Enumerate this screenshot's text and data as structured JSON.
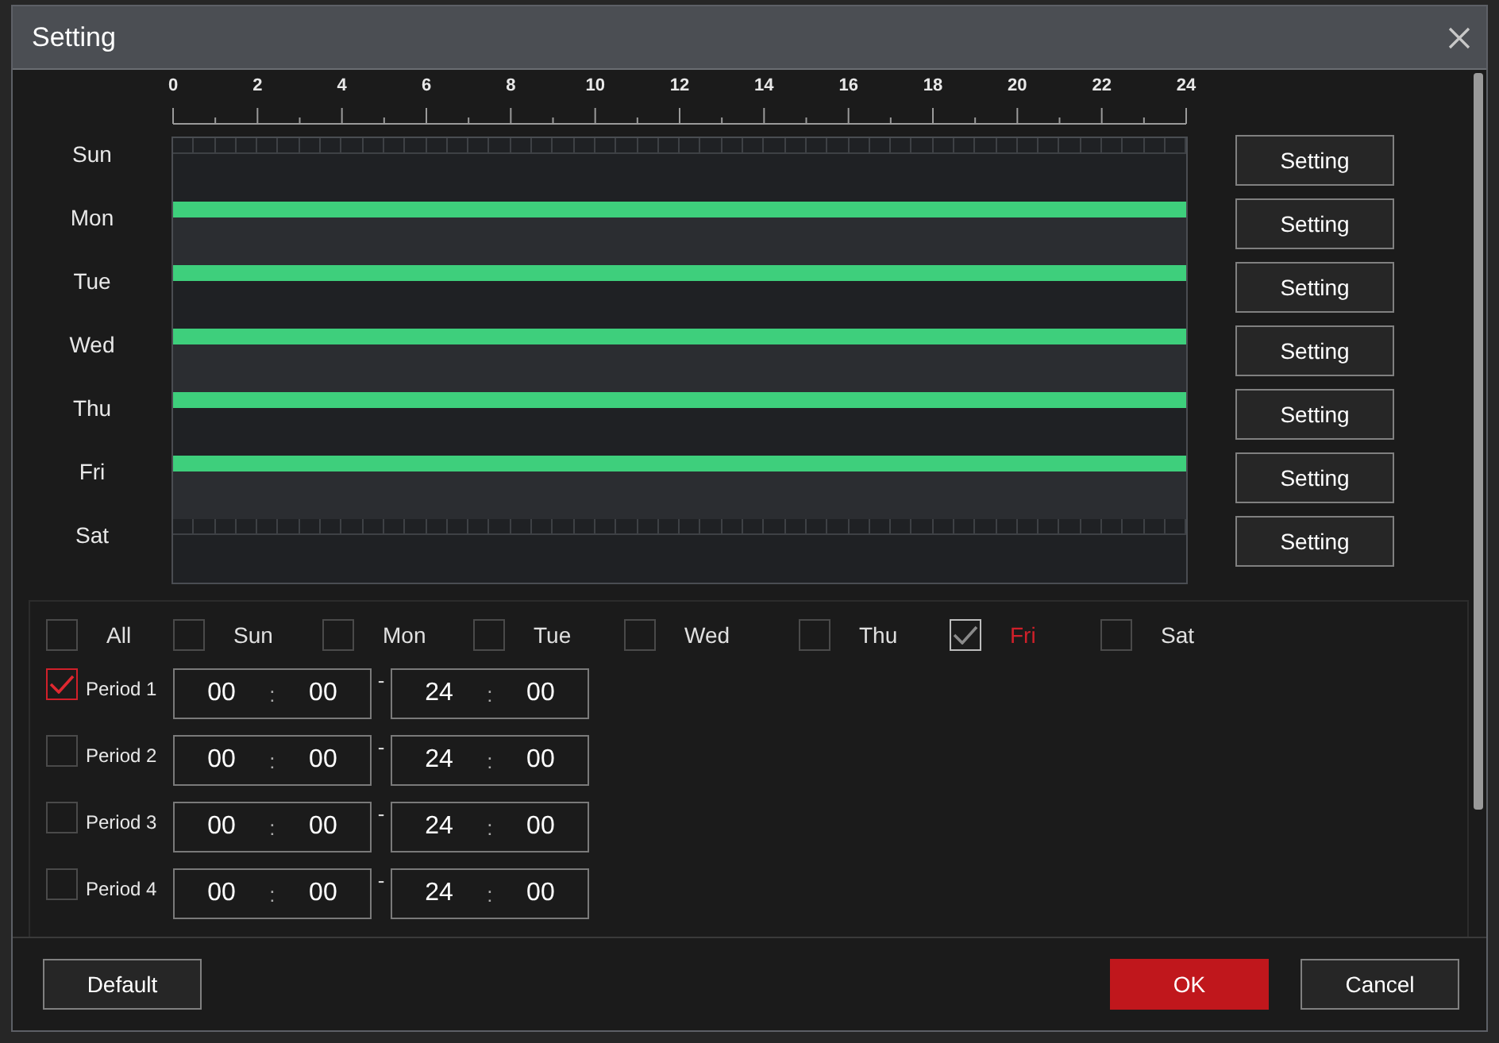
{
  "window": {
    "title": "Setting"
  },
  "axis": {
    "labels": [
      "0",
      "2",
      "4",
      "6",
      "8",
      "10",
      "12",
      "14",
      "16",
      "18",
      "20",
      "22",
      "24"
    ]
  },
  "days": [
    {
      "label": "Sun",
      "kind": "grid",
      "button": "Setting"
    },
    {
      "label": "Mon",
      "kind": "bar",
      "level": 1,
      "button": "Setting"
    },
    {
      "label": "Tue",
      "kind": "bar",
      "level": 1,
      "button": "Setting"
    },
    {
      "label": "Wed",
      "kind": "bar",
      "level": 1,
      "button": "Setting"
    },
    {
      "label": "Thu",
      "kind": "bar",
      "level": 1,
      "button": "Setting"
    },
    {
      "label": "Fri",
      "kind": "bar",
      "level": 1,
      "button": "Setting"
    },
    {
      "label": "Sat",
      "kind": "grid",
      "button": "Setting"
    }
  ],
  "day_checks": [
    {
      "label": "All",
      "checked": false,
      "selected": false
    },
    {
      "label": "Sun",
      "checked": false,
      "selected": false
    },
    {
      "label": "Mon",
      "checked": false,
      "selected": false
    },
    {
      "label": "Tue",
      "checked": false,
      "selected": false
    },
    {
      "label": "Wed",
      "checked": false,
      "selected": false
    },
    {
      "label": "Thu",
      "checked": false,
      "selected": false
    },
    {
      "label": "Fri",
      "checked": true,
      "selected": true
    },
    {
      "label": "Sat",
      "checked": false,
      "selected": false
    }
  ],
  "periods": [
    {
      "label": "Period 1",
      "checked": true,
      "start": {
        "hour": "00",
        "colon": ":",
        "minute": "00"
      },
      "dash": "-",
      "end": {
        "hour": "24",
        "colon": ":",
        "minute": "00"
      }
    },
    {
      "label": "Period 2",
      "checked": false,
      "start": {
        "hour": "00",
        "colon": ":",
        "minute": "00"
      },
      "dash": "-",
      "end": {
        "hour": "24",
        "colon": ":",
        "minute": "00"
      }
    },
    {
      "label": "Period 3",
      "checked": false,
      "start": {
        "hour": "00",
        "colon": ":",
        "minute": "00"
      },
      "dash": "-",
      "end": {
        "hour": "24",
        "colon": ":",
        "minute": "00"
      }
    },
    {
      "label": "Period 4",
      "checked": false,
      "start": {
        "hour": "00",
        "colon": ":",
        "minute": "00"
      },
      "dash": "-",
      "end": {
        "hour": "24",
        "colon": ":",
        "minute": "00"
      }
    }
  ],
  "footer": {
    "default": "Default",
    "ok": "OK",
    "cancel": "Cancel"
  }
}
